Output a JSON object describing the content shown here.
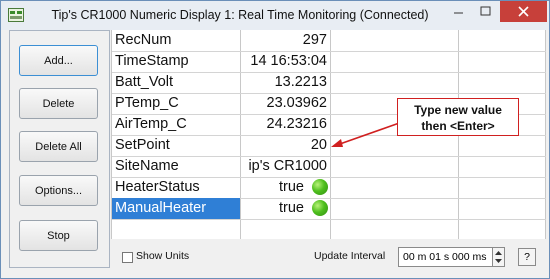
{
  "window": {
    "title": "Tip's CR1000 Numeric Display 1: Real Time Monitoring (Connected)",
    "icon": "app-icon",
    "controls": [
      "minimize-icon",
      "maximize-icon",
      "close-icon"
    ]
  },
  "buttons": {
    "add": "Add...",
    "delete": "Delete",
    "delete_all": "Delete All",
    "options": "Options...",
    "stop": "Stop"
  },
  "table": {
    "rows": [
      {
        "name": "RecNum",
        "value": "297"
      },
      {
        "name": "TimeStamp",
        "value": "14 16:53:04"
      },
      {
        "name": "Batt_Volt",
        "value": "13.2213"
      },
      {
        "name": "PTemp_C",
        "value": "23.03962"
      },
      {
        "name": "AirTemp_C",
        "value": "24.23216"
      },
      {
        "name": "SetPoint",
        "value": "20"
      },
      {
        "name": "SiteName",
        "value": "ip's CR1000"
      },
      {
        "name": "HeaterStatus",
        "value": "true",
        "led": "green"
      },
      {
        "name": "ManualHeater",
        "value": "true",
        "led": "green",
        "selected": true
      }
    ]
  },
  "callout": {
    "line1": "Type new value",
    "line2": "then <Enter>",
    "color": "#d02020"
  },
  "bottom": {
    "show_units_label": "Show Units",
    "show_units_checked": false,
    "update_interval_label": "Update Interval",
    "update_interval_value": "00 m 01 s 000 ms",
    "help_label": "?"
  },
  "colors": {
    "selection": "#2f7fd6",
    "led_on": "#4fbf1e",
    "close_button": "#c7403a"
  }
}
